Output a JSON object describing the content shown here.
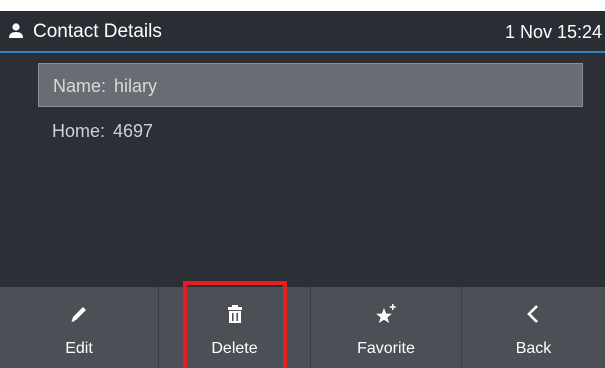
{
  "header": {
    "title": "Contact Details",
    "time": "1 Nov 15:24",
    "icon": "contact-icon"
  },
  "contact": {
    "fields": [
      {
        "label": "Name:",
        "value": "hilary",
        "selected": true
      },
      {
        "label": "Home:",
        "value": "4697",
        "selected": false
      }
    ]
  },
  "softkeys": [
    {
      "label": "Edit",
      "icon": "pencil-icon"
    },
    {
      "label": "Delete",
      "icon": "trash-icon"
    },
    {
      "label": "Favorite",
      "icon": "star-plus-icon"
    },
    {
      "label": "Back",
      "icon": "chevron-left-icon"
    }
  ],
  "colors": {
    "background": "#2c2f36",
    "header_underline": "#2f7fc1",
    "selected_row": "#686c73",
    "softkey_bar": "#4c5056",
    "highlight": "#e32020"
  }
}
